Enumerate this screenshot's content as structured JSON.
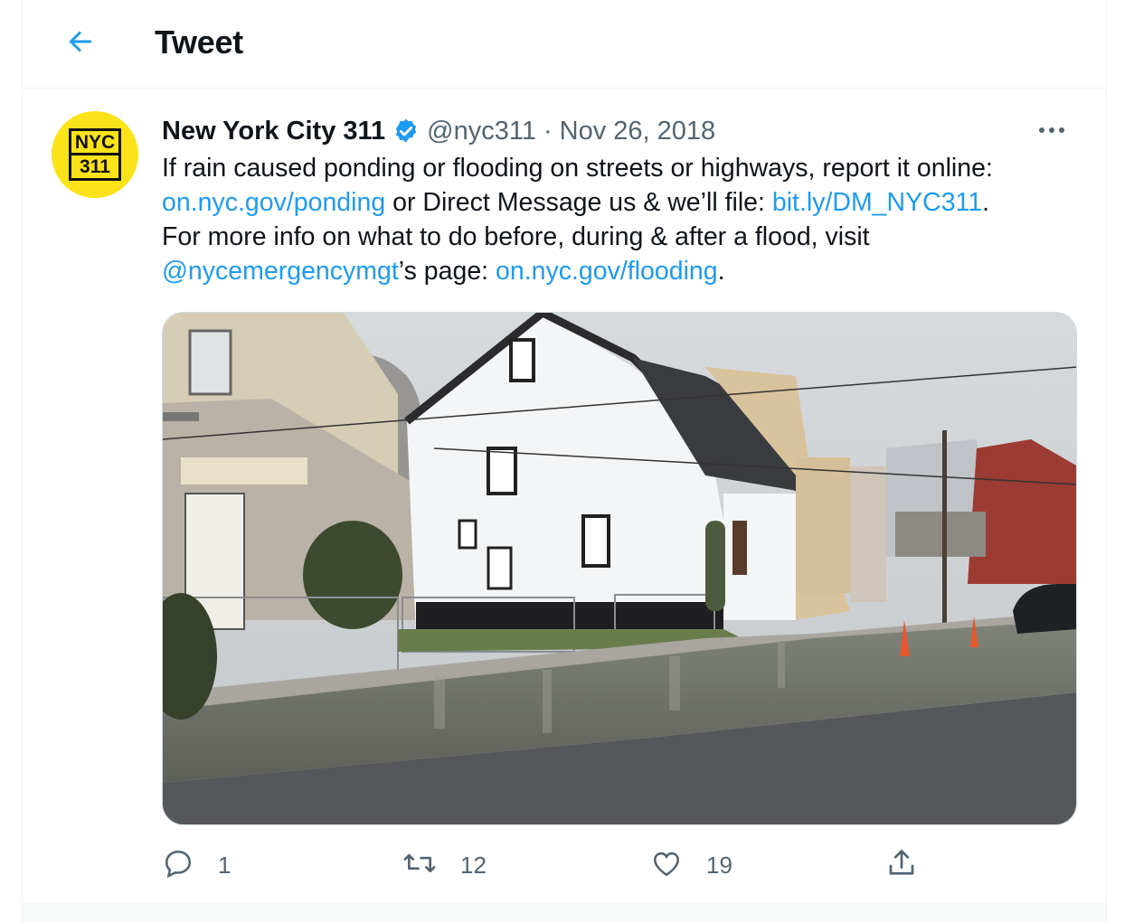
{
  "header": {
    "title": "Tweet",
    "back_icon": "arrow-left-icon",
    "accent": "#1d9bf0"
  },
  "author": {
    "name": "New York City 311",
    "handle": "@nyc311",
    "separator": "·",
    "date": "Nov 26, 2018",
    "verified": true,
    "avatar_color": "#fce319",
    "logo_top": "NYC",
    "logo_bottom": "311"
  },
  "tweet": {
    "line1": "If rain caused ponding or flooding on streets or highways, report it online:",
    "link1": "on.nyc.gov/ponding",
    "mid1": " or Direct Message us & we’ll file: ",
    "link2": "bit.ly/DM_NYC311",
    "end1": ".",
    "line3": "For more info on what to do before, during & after a flood, visit",
    "mention": "@nycemergencymgt",
    "mid2": "’s page: ",
    "link3": "on.nyc.gov/flooding",
    "end2": ".",
    "link_color": "#1d9bf0"
  },
  "media": {
    "kind": "photo",
    "subject": "flooded residential street"
  },
  "actions": {
    "replies": "1",
    "retweets": "12",
    "likes": "19",
    "icons": [
      "reply-icon",
      "retweet-icon",
      "like-icon",
      "share-icon"
    ]
  }
}
